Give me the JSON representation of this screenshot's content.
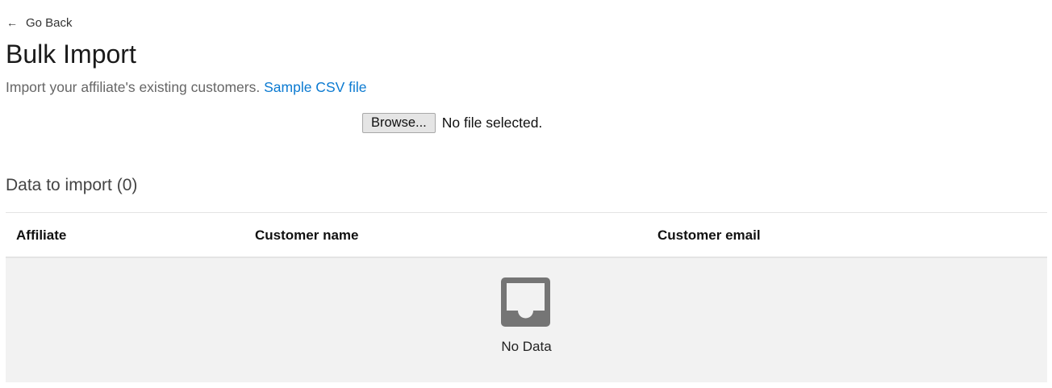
{
  "nav": {
    "back_arrow": "←",
    "back_label": "Go Back"
  },
  "header": {
    "title": "Bulk Import",
    "subtitle": "Import your affiliate's existing customers.",
    "sample_link": "Sample CSV file"
  },
  "file_input": {
    "button_label": "Browse...",
    "status": "No file selected."
  },
  "import_section": {
    "title": "Data to import (0)"
  },
  "table": {
    "columns": [
      "Affiliate",
      "Customer name",
      "Customer email"
    ],
    "rows": [],
    "empty": {
      "icon": "inbox-icon",
      "text": "No Data"
    }
  },
  "colors": {
    "link": "#0b7ad1",
    "empty_bg": "#f2f2f2",
    "icon": "#757575"
  }
}
